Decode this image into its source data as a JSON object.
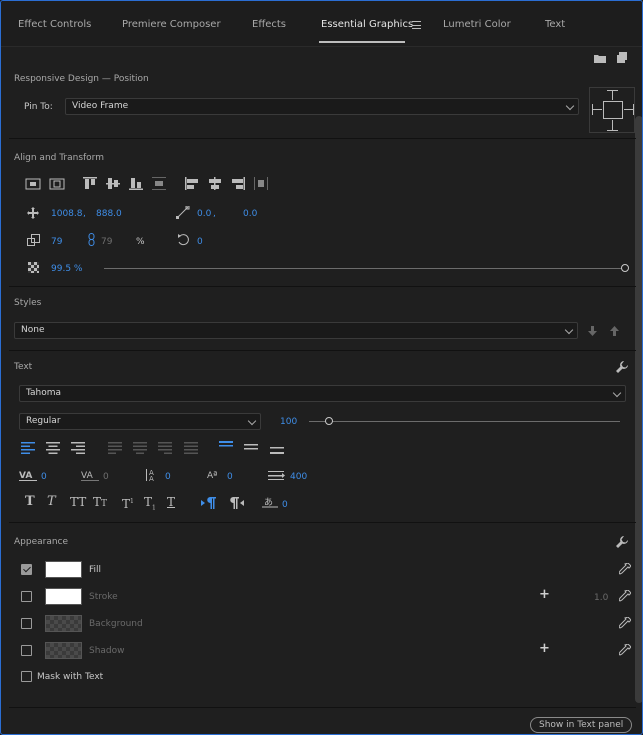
{
  "tabs": [
    "Effect Controls",
    "Premiere Composer",
    "Effects",
    "Essential Graphics",
    "Lumetri Color",
    "Text"
  ],
  "responsive": {
    "title": "Responsive Design — Position",
    "pin_to_label": "Pin To:",
    "pin_to_value": "Video Frame"
  },
  "align": {
    "title": "Align and Transform",
    "pos_x": "1008.8",
    "pos_sep": ",",
    "pos_y": "888.0",
    "anchor_x": "0.0",
    "anchor_sep": ",",
    "anchor_y": "0.0",
    "scale": "79",
    "scale_linked": "79",
    "scale_unit": "%",
    "rotation": "0",
    "opacity": "99.5 %"
  },
  "styles": {
    "title": "Styles",
    "value": "None"
  },
  "text": {
    "title": "Text",
    "font": "Tahoma",
    "style": "Regular",
    "size": "100",
    "size_fraction": 0.05,
    "kerning": "0",
    "tracking": "0",
    "leading": "0",
    "baseline": "0",
    "tab_width": "400",
    "tsume": "0"
  },
  "appearance": {
    "title": "Appearance",
    "fill_label": "Fill",
    "stroke_label": "Stroke",
    "stroke_width": "1.0",
    "background_label": "Background",
    "shadow_label": "Shadow",
    "mask_label": "Mask with Text",
    "fill_checked": true,
    "stroke_checked": false,
    "background_checked": false,
    "shadow_checked": false,
    "mask_checked": false
  },
  "footer": {
    "show_text_panel": "Show in Text panel"
  },
  "colors": {
    "accent_blue": "#3f8ee8",
    "frame_border": "#2b6ed3",
    "panel_bg": "#1f1f1f"
  }
}
